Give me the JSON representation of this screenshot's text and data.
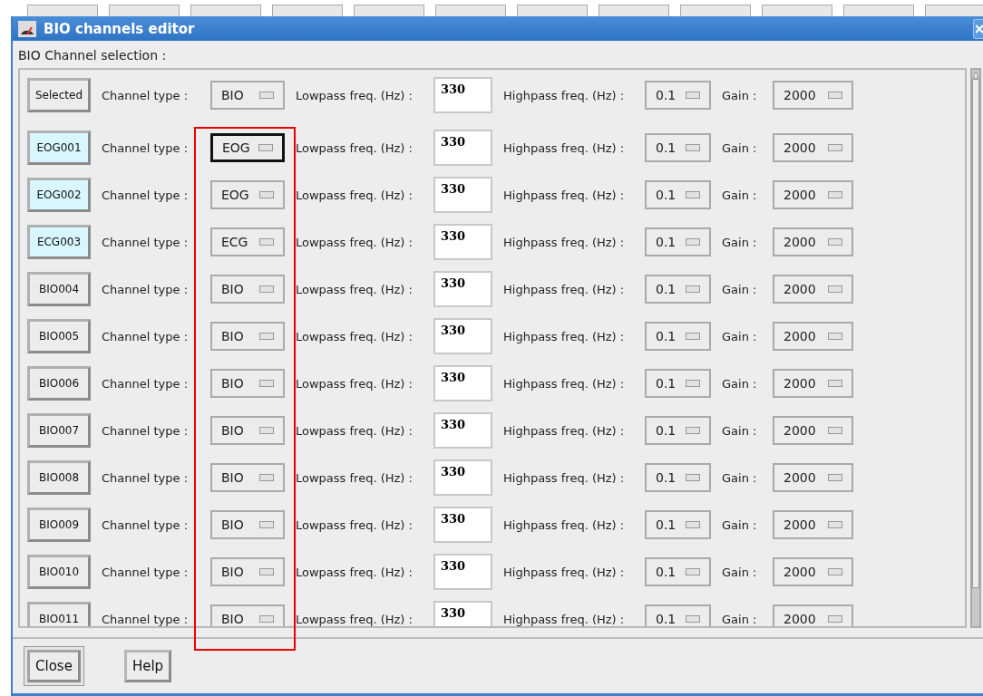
{
  "window": {
    "title": "BIO channels editor"
  },
  "section_label": "BIO Channel selection :",
  "header_row": {
    "button": "Selected",
    "type_label": "Channel type :",
    "type": "BIO",
    "lowpass_label": "Lowpass freq. (Hz) :",
    "lowpass": "330",
    "highpass_label": "Highpass freq. (Hz) :",
    "highpass": "0.1",
    "gain_label": "Gain :",
    "gain": "2000"
  },
  "channels": [
    {
      "name": "EOG001",
      "selected": true,
      "focused": true,
      "type_label": "Channel type :",
      "type": "EOG",
      "lowpass_label": "Lowpass freq. (Hz) :",
      "lowpass": "330",
      "highpass_label": "Highpass freq. (Hz) :",
      "highpass": "0.1",
      "gain_label": "Gain :",
      "gain": "2000"
    },
    {
      "name": "EOG002",
      "selected": true,
      "focused": false,
      "type_label": "Channel type :",
      "type": "EOG",
      "lowpass_label": "Lowpass freq. (Hz) :",
      "lowpass": "330",
      "highpass_label": "Highpass freq. (Hz) :",
      "highpass": "0.1",
      "gain_label": "Gain :",
      "gain": "2000"
    },
    {
      "name": "ECG003",
      "selected": true,
      "focused": false,
      "type_label": "Channel type :",
      "type": "ECG",
      "lowpass_label": "Lowpass freq. (Hz) :",
      "lowpass": "330",
      "highpass_label": "Highpass freq. (Hz) :",
      "highpass": "0.1",
      "gain_label": "Gain :",
      "gain": "2000"
    },
    {
      "name": "BIO004",
      "selected": false,
      "focused": false,
      "type_label": "Channel type :",
      "type": "BIO",
      "lowpass_label": "Lowpass freq. (Hz) :",
      "lowpass": "330",
      "highpass_label": "Highpass freq. (Hz) :",
      "highpass": "0.1",
      "gain_label": "Gain :",
      "gain": "2000"
    },
    {
      "name": "BIO005",
      "selected": false,
      "focused": false,
      "type_label": "Channel type :",
      "type": "BIO",
      "lowpass_label": "Lowpass freq. (Hz) :",
      "lowpass": "330",
      "highpass_label": "Highpass freq. (Hz) :",
      "highpass": "0.1",
      "gain_label": "Gain :",
      "gain": "2000"
    },
    {
      "name": "BIO006",
      "selected": false,
      "focused": false,
      "type_label": "Channel type :",
      "type": "BIO",
      "lowpass_label": "Lowpass freq. (Hz) :",
      "lowpass": "330",
      "highpass_label": "Highpass freq. (Hz) :",
      "highpass": "0.1",
      "gain_label": "Gain :",
      "gain": "2000"
    },
    {
      "name": "BIO007",
      "selected": false,
      "focused": false,
      "type_label": "Channel type :",
      "type": "BIO",
      "lowpass_label": "Lowpass freq. (Hz) :",
      "lowpass": "330",
      "highpass_label": "Highpass freq. (Hz) :",
      "highpass": "0.1",
      "gain_label": "Gain :",
      "gain": "2000"
    },
    {
      "name": "BIO008",
      "selected": false,
      "focused": false,
      "type_label": "Channel type :",
      "type": "BIO",
      "lowpass_label": "Lowpass freq. (Hz) :",
      "lowpass": "330",
      "highpass_label": "Highpass freq. (Hz) :",
      "highpass": "0.1",
      "gain_label": "Gain :",
      "gain": "2000"
    },
    {
      "name": "BIO009",
      "selected": false,
      "focused": false,
      "type_label": "Channel type :",
      "type": "BIO",
      "lowpass_label": "Lowpass freq. (Hz) :",
      "lowpass": "330",
      "highpass_label": "Highpass freq. (Hz) :",
      "highpass": "0.1",
      "gain_label": "Gain :",
      "gain": "2000"
    },
    {
      "name": "BIO010",
      "selected": false,
      "focused": false,
      "type_label": "Channel type :",
      "type": "BIO",
      "lowpass_label": "Lowpass freq. (Hz) :",
      "lowpass": "330",
      "highpass_label": "Highpass freq. (Hz) :",
      "highpass": "0.1",
      "gain_label": "Gain :",
      "gain": "2000"
    },
    {
      "name": "BIO011",
      "selected": false,
      "focused": false,
      "type_label": "Channel type :",
      "type": "BIO",
      "lowpass_label": "Lowpass freq. (Hz) :",
      "lowpass": "330",
      "highpass_label": "Highpass freq. (Hz) :",
      "highpass": "0.1",
      "gain_label": "Gain :",
      "gain": "2000"
    }
  ],
  "buttons": [
    {
      "label": "Close",
      "default": true
    },
    {
      "label": "Help",
      "default": false
    }
  ]
}
